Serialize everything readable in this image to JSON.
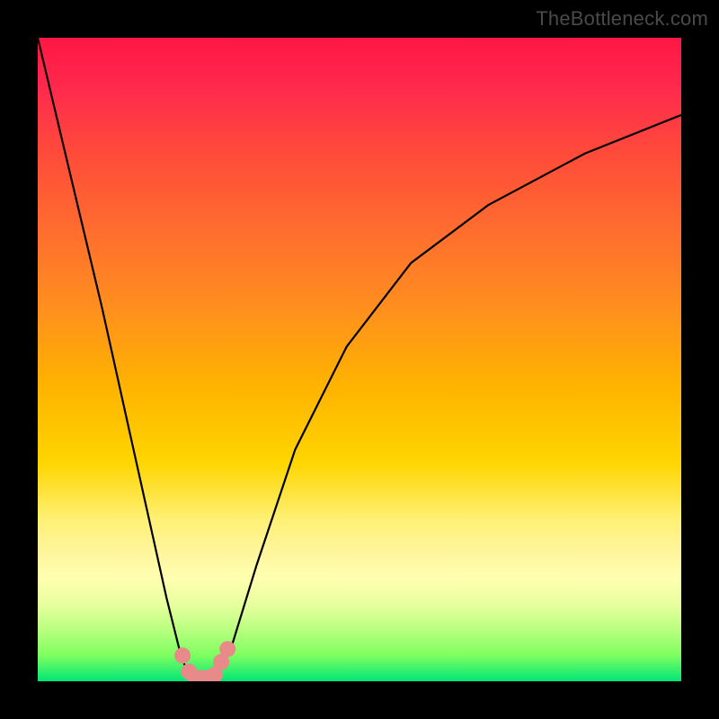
{
  "watermark": "TheBottleneck.com",
  "chart_data": {
    "type": "line",
    "title": "",
    "xlabel": "",
    "ylabel": "",
    "xlim": [
      0,
      100
    ],
    "ylim": [
      0,
      100
    ],
    "grid": false,
    "series": [
      {
        "name": "bottleneck-curve",
        "x": [
          0,
          5,
          10,
          14,
          18,
          20,
          22,
          23,
          24,
          25,
          26,
          27,
          28,
          30,
          34,
          40,
          48,
          58,
          70,
          85,
          100
        ],
        "y": [
          100,
          79,
          58,
          40,
          22,
          13,
          5,
          2,
          0,
          0,
          0,
          0,
          1,
          5,
          18,
          36,
          52,
          65,
          74,
          82,
          88
        ]
      }
    ],
    "markers": {
      "name": "highlight-points",
      "x": [
        22.5,
        23.5,
        24.5,
        25.5,
        26.5,
        27.5,
        28.5,
        29.5
      ],
      "y": [
        4,
        1.5,
        0.5,
        0.5,
        0.5,
        1,
        3,
        5
      ],
      "color": "#e88a8a"
    },
    "background_gradient": [
      {
        "pos": 0,
        "color": "#ff1744"
      },
      {
        "pos": 50,
        "color": "#ffb300"
      },
      {
        "pos": 80,
        "color": "#fff59d"
      },
      {
        "pos": 100,
        "color": "#00e676"
      }
    ]
  }
}
